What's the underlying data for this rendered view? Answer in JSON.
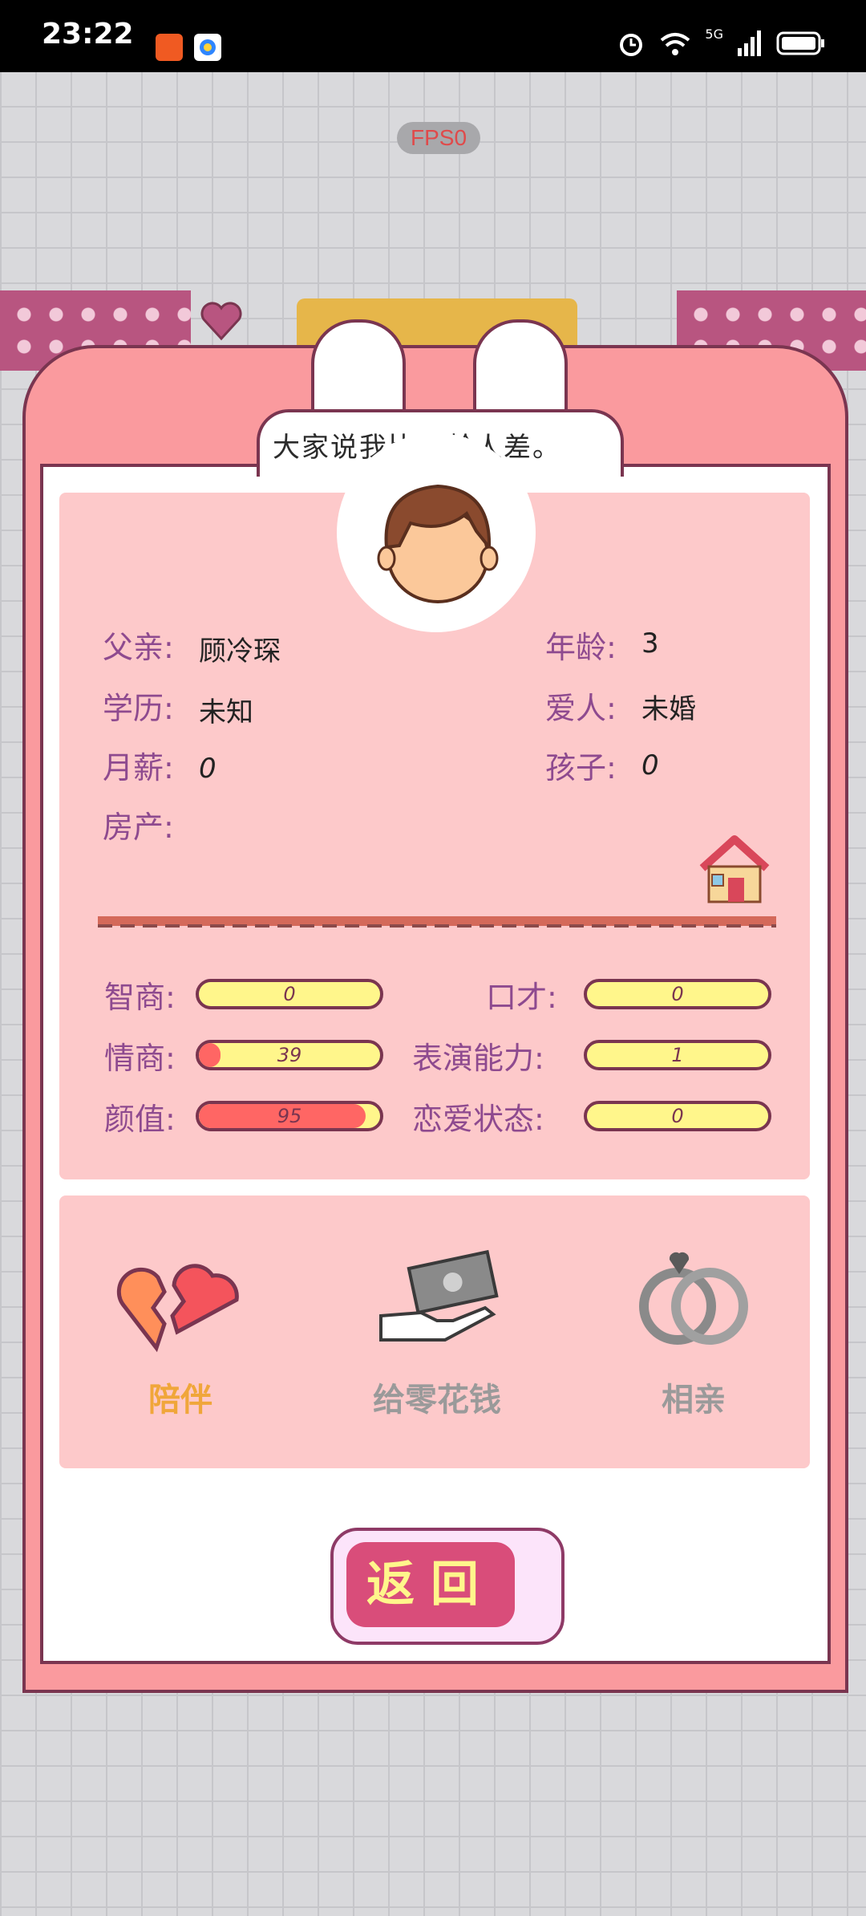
{
  "status_bar": {
    "time": "23:22",
    "network": "5G",
    "icons": [
      "app-icon-orange",
      "app-icon-colorful",
      "alarm-icon",
      "wifi-icon",
      "signal-icon",
      "battery-icon"
    ]
  },
  "fps_badge": "FPS0",
  "speech_bubble": "大家说我比同龄人差。",
  "profile": {
    "father_label": "父亲:",
    "father_value": "顾冷琛",
    "age_label": "年龄:",
    "age_value": "3",
    "education_label": "学历:",
    "education_value": "未知",
    "spouse_label": "爱人:",
    "spouse_value": "未婚",
    "salary_label": "月薪:",
    "salary_value": "0",
    "children_label": "孩子:",
    "children_value": "0",
    "property_label": "房产:"
  },
  "stats": [
    {
      "label": "智商:",
      "value": "0",
      "fill_pct": 0
    },
    {
      "label": "口才:",
      "value": "0",
      "fill_pct": 0
    },
    {
      "label": "情商:",
      "value": "39",
      "fill_pct": 12
    },
    {
      "label": "表演能力:",
      "value": "1",
      "fill_pct": 0
    },
    {
      "label": "颜值:",
      "value": "95",
      "fill_pct": 92
    },
    {
      "label": "恋爱状态:",
      "value": "0",
      "fill_pct": 0
    }
  ],
  "actions": [
    {
      "label": "陪伴",
      "icon": "broken-heart-icon",
      "color": "#f0a63a"
    },
    {
      "label": "给零花钱",
      "icon": "money-hand-icon",
      "color": "#9a9a9a"
    },
    {
      "label": "相亲",
      "icon": "rings-icon",
      "color": "#9a9a9a"
    }
  ],
  "back_button": "返回",
  "colors": {
    "panel": "#fa9a9e",
    "box": "#fdc9ca",
    "bar": "#fff68b",
    "bar_fill": "#ff6664",
    "border": "#7a3550"
  }
}
